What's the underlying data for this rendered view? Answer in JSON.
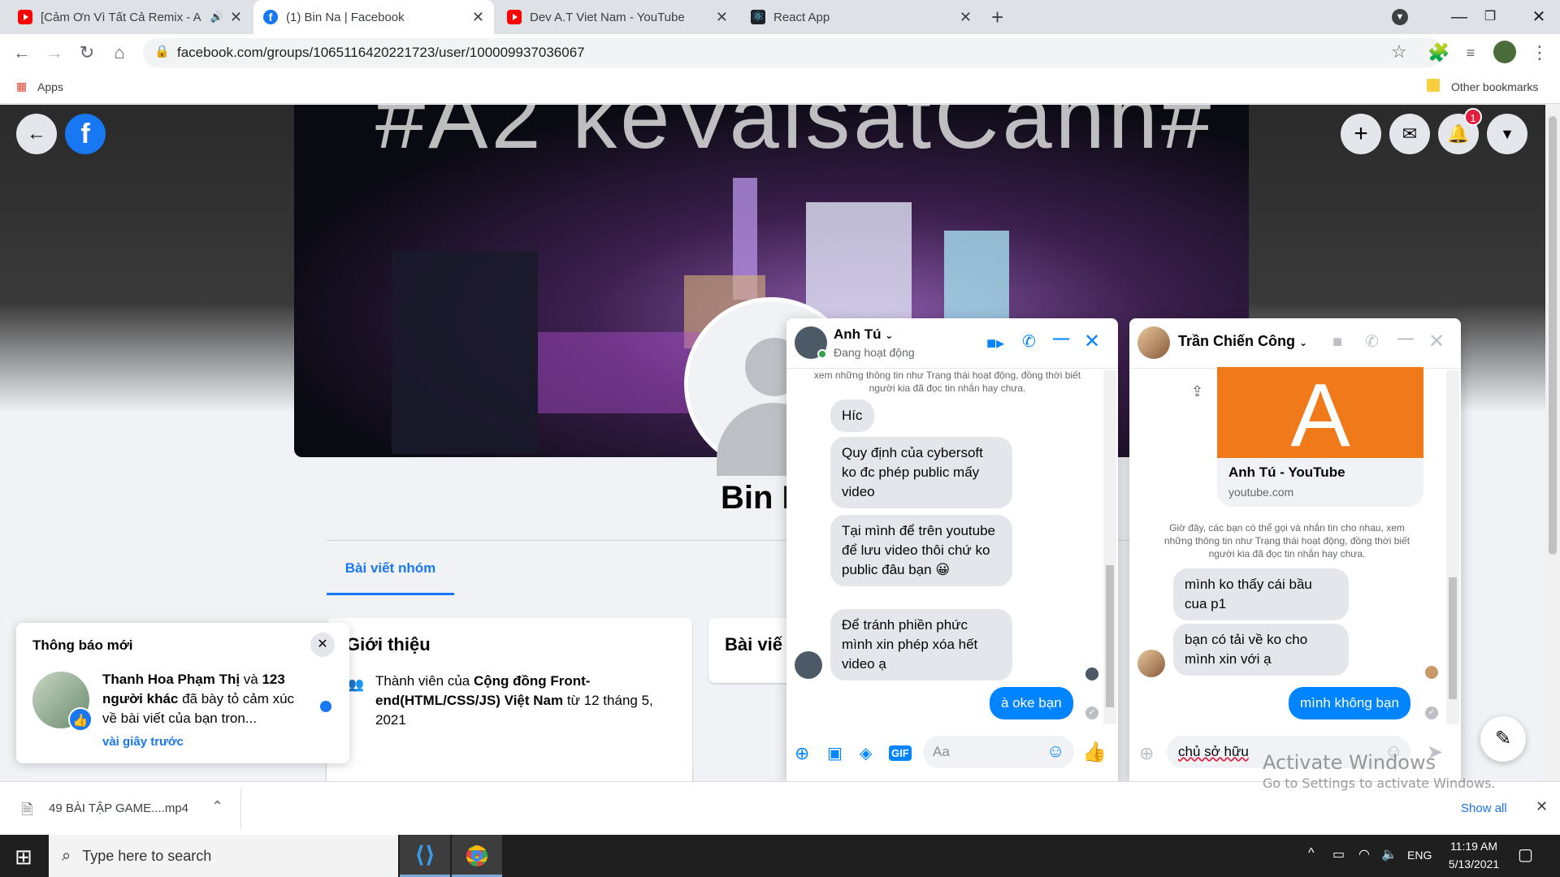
{
  "browser": {
    "tabs": [
      {
        "title": "[Cảm Ơn Vì Tất Cả Remix - A",
        "icon": "youtube-icon",
        "audio": true
      },
      {
        "title": "(1) Bin Na | Facebook",
        "icon": "facebook-icon"
      },
      {
        "title": "Dev A.T Viet Nam - YouTube",
        "icon": "youtube-icon"
      },
      {
        "title": "React App",
        "icon": "react-icon"
      }
    ],
    "url": "facebook.com/groups/1065116420221723/user/100009937036067",
    "bookmarks": {
      "apps": "Apps",
      "other": "Other bookmarks"
    }
  },
  "facebook": {
    "cover_text": "#A2 keVaisatCanh#",
    "profile_name": "Bin N",
    "notification_badge": "1",
    "group_tab": "Bài viết nhóm",
    "intro": {
      "title": "Giới thiệu",
      "member_prefix": "Thành viên của ",
      "group_name": "Cộng đồng Front-end(HTML/CSS/JS) Việt Nam",
      "member_suffix": " từ 12 tháng 5, 2021"
    },
    "posts_title": "Bài viế",
    "notification": {
      "heading": "Thông báo mới",
      "actor": "Thanh Hoa Phạm Thị",
      "joiner": " và ",
      "others": "123 người khác",
      "text": " đã bày tỏ cảm xúc về bài viết của bạn tron...",
      "time": "vài giây trước"
    }
  },
  "chat1": {
    "name": "Anh Tú",
    "status": "Đang hoạt động",
    "sys_note": "xem những thông tin như Trạng thái hoạt động, đồng thời biết người kia đã đọc tin nhắn hay chưa.",
    "messages": [
      {
        "text": "Híc",
        "from": "them"
      },
      {
        "text": "Quy định của cybersoft ko đc phép public mấy video",
        "from": "them"
      },
      {
        "text": "Tại mình để trên youtube để lưu video thôi chứ ko public đâu bạn 😀",
        "from": "them"
      },
      {
        "text": "Để tránh phiền phức mình xin phép xóa hết video ạ",
        "from": "them"
      },
      {
        "text": "à oke bạn",
        "from": "me"
      }
    ],
    "input_placeholder": "Aa"
  },
  "chat2": {
    "name": "Trần Chiến Công",
    "link_title": "Anh Tú - YouTube",
    "link_domain": "youtube.com",
    "sys_note": "Giờ đây, các bạn có thể gọi và nhắn tin cho nhau, xem những thông tin như Trạng thái hoạt động, đồng thời biết người kia đã đọc tin nhắn hay chưa.",
    "messages": [
      {
        "text": "mình ko thấy cái bầu cua p1",
        "from": "them"
      },
      {
        "text": "bạn có tải về ko cho mình xin với ạ",
        "from": "them"
      },
      {
        "text": "mình không bạn",
        "from": "me"
      }
    ],
    "input_value": "chủ sở hữu"
  },
  "download": {
    "file": "49 BÀI TẬP GAME....mp4",
    "show_all": "Show all"
  },
  "taskbar": {
    "search": "Type here to search",
    "time": "11:19 AM",
    "date": "5/13/2021",
    "lang": "ENG"
  },
  "watermark": {
    "title": "Activate Windows",
    "sub": "Go to Settings to activate Windows."
  },
  "colors": {
    "fb_blue": "#1877f2",
    "messenger_blue": "#0084ff"
  }
}
